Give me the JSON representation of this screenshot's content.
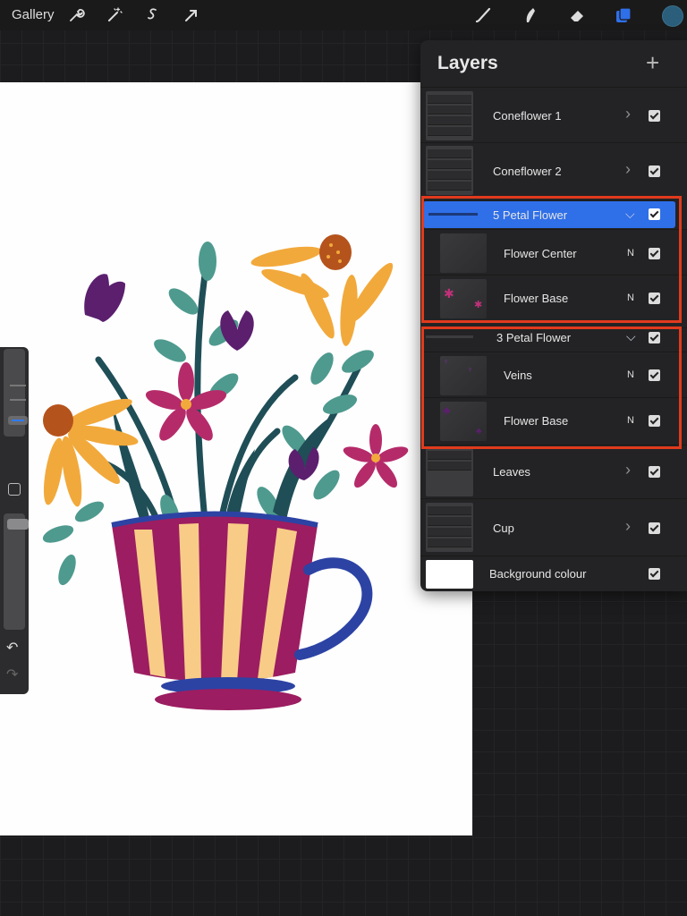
{
  "toolbar": {
    "gallery_label": "Gallery",
    "left_tools": [
      "wrench-icon",
      "magic-wand-icon",
      "selection-icon",
      "transform-arrow-icon"
    ],
    "right_tools": [
      "brush-icon",
      "smudge-icon",
      "eraser-icon",
      "layers-icon",
      "color-swatch-icon"
    ],
    "active_tool": "layers-icon",
    "accent_color": "#2f6fe8",
    "current_color": "#2b5e7a"
  },
  "layers_panel": {
    "title": "Layers",
    "add_symbol": "+",
    "layers": [
      {
        "name": "Coneflower 1",
        "type": "group",
        "expanded": false,
        "visible": true
      },
      {
        "name": "Coneflower 2",
        "type": "group",
        "expanded": false,
        "visible": true
      },
      {
        "name": "5 Petal Flower",
        "type": "group",
        "expanded": true,
        "selected": true,
        "visible": true,
        "children": [
          {
            "name": "Flower Center",
            "blend": "N",
            "visible": true
          },
          {
            "name": "Flower Base",
            "blend": "N",
            "visible": true
          }
        ]
      },
      {
        "name": "3 Petal Flower",
        "type": "group",
        "expanded": true,
        "visible": true,
        "children": [
          {
            "name": "Veins",
            "blend": "N",
            "visible": true
          },
          {
            "name": "Flower Base",
            "blend": "N",
            "visible": true
          }
        ]
      },
      {
        "name": "Leaves",
        "type": "group",
        "expanded": false,
        "visible": true
      },
      {
        "name": "Cup",
        "type": "group",
        "expanded": false,
        "visible": true
      },
      {
        "name": "Background colour",
        "type": "background",
        "visible": true
      }
    ]
  },
  "sidebar": {
    "undo_icon": "undo-icon",
    "redo_icon": "redo-icon",
    "modifier_icon": "modifier-square-icon"
  },
  "highlight_color": "#e13a1d",
  "canvas": {
    "illustration": "flowers-in-teacup"
  }
}
